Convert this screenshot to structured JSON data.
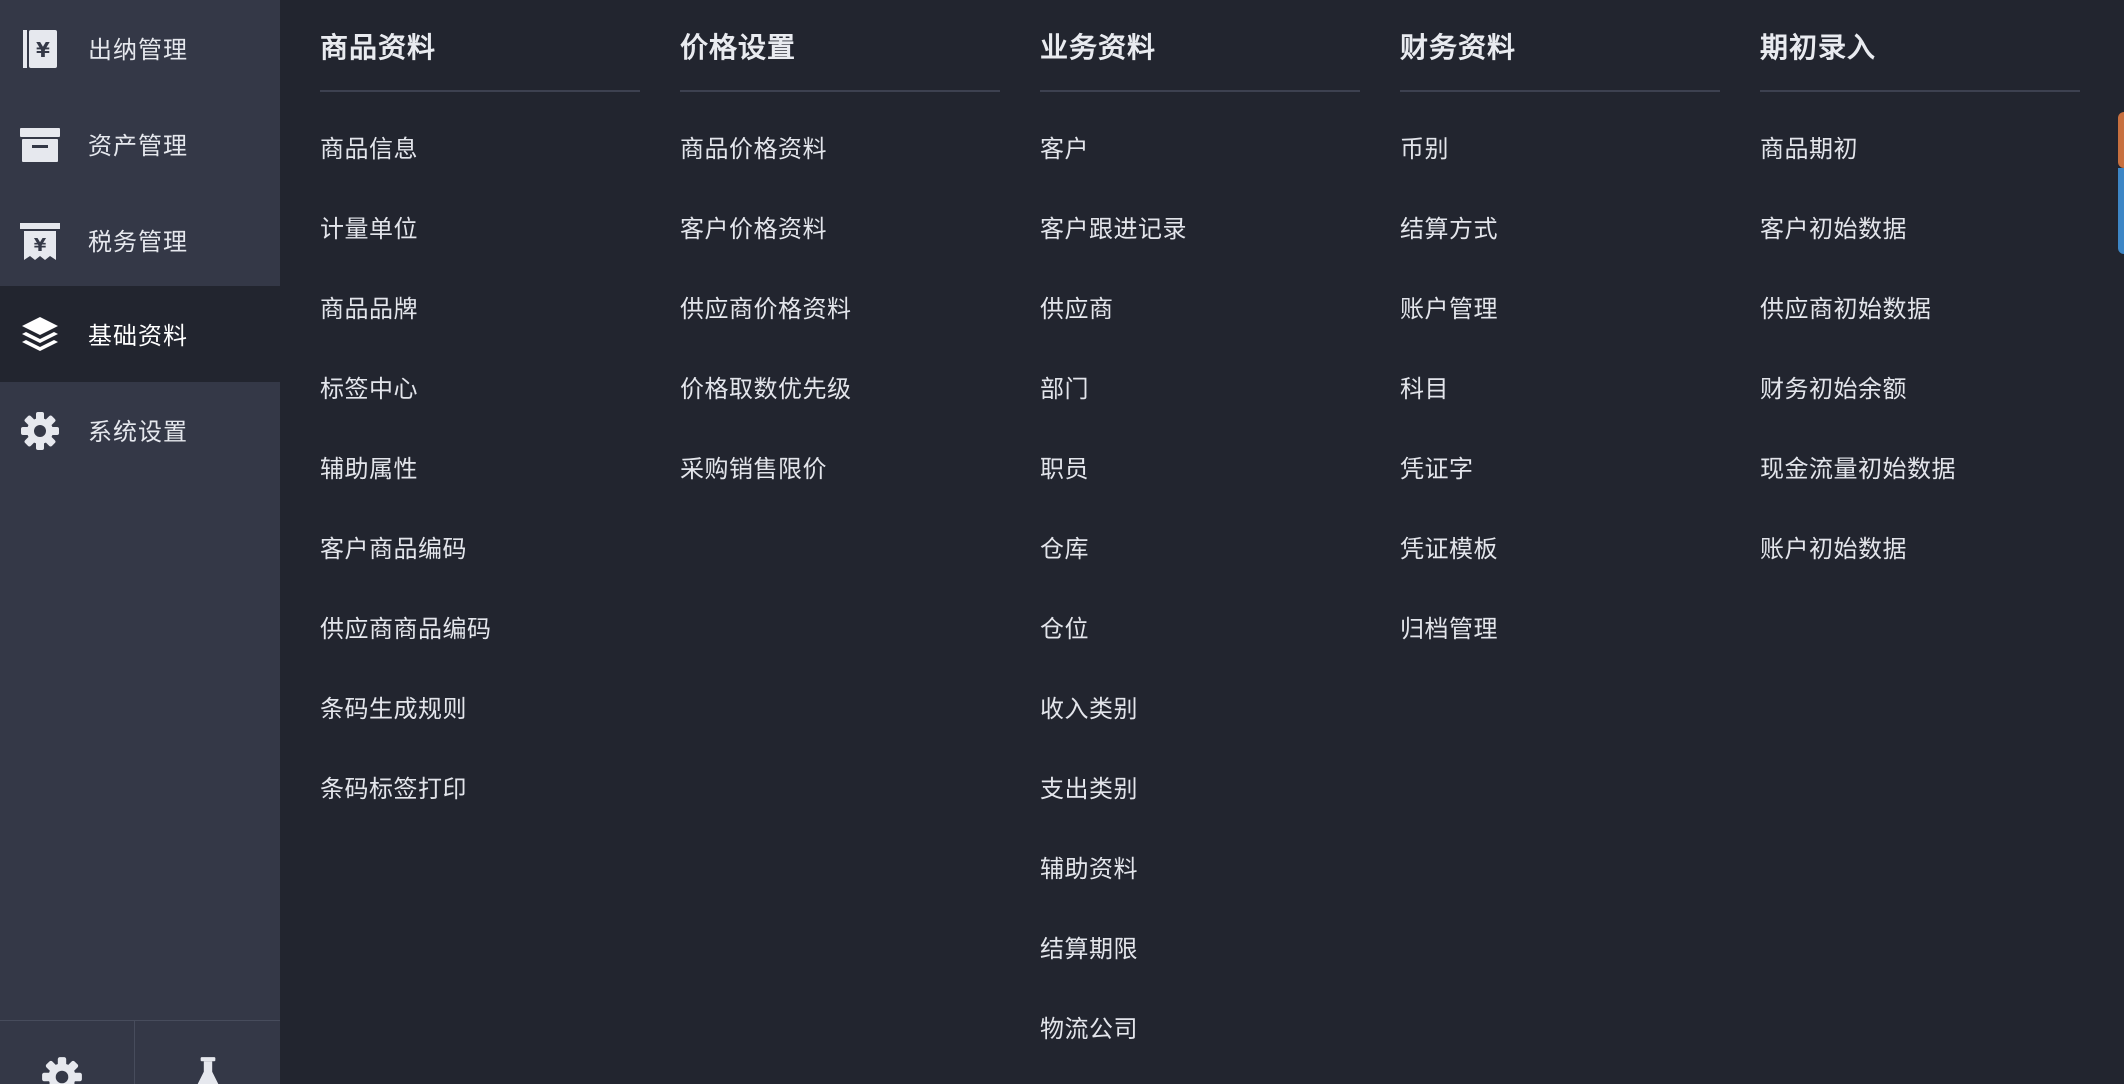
{
  "sidebar": {
    "items": [
      {
        "label": "出纳管理",
        "icon": "cashier-book-icon"
      },
      {
        "label": "资产管理",
        "icon": "archive-box-icon"
      },
      {
        "label": "税务管理",
        "icon": "tax-receipt-icon"
      },
      {
        "label": "基础资料",
        "icon": "layers-icon",
        "active": true
      },
      {
        "label": "系统设置",
        "icon": "gear-icon"
      }
    ],
    "footer": [
      "settings-gear-icon",
      "lab-flask-icon"
    ]
  },
  "menu": {
    "columns": [
      {
        "title": "商品资料",
        "items": [
          "商品信息",
          "计量单位",
          "商品品牌",
          "标签中心",
          "辅助属性",
          "客户商品编码",
          "供应商商品编码",
          "条码生成规则",
          "条码标签打印"
        ]
      },
      {
        "title": "价格设置",
        "items": [
          "商品价格资料",
          "客户价格资料",
          "供应商价格资料",
          "价格取数优先级",
          "采购销售限价"
        ]
      },
      {
        "title": "业务资料",
        "items": [
          "客户",
          "客户跟进记录",
          "供应商",
          "部门",
          "职员",
          "仓库",
          "仓位",
          "收入类别",
          "支出类别",
          "辅助资料",
          "结算期限",
          "物流公司"
        ]
      },
      {
        "title": "财务资料",
        "items": [
          "币别",
          "结算方式",
          "账户管理",
          "科目",
          "凭证字",
          "凭证模板",
          "归档管理"
        ]
      },
      {
        "title": "期初录入",
        "items": [
          "商品期初",
          "客户初始数据",
          "供应商初始数据",
          "财务初始余额",
          "现金流量初始数据",
          "账户初始数据"
        ]
      }
    ]
  },
  "colors": {
    "sidebar_bg": "#343847",
    "panel_bg": "#22252f",
    "text": "#e6e8ee",
    "edge_orange": "#c8703f",
    "edge_blue": "#3d86c6"
  }
}
